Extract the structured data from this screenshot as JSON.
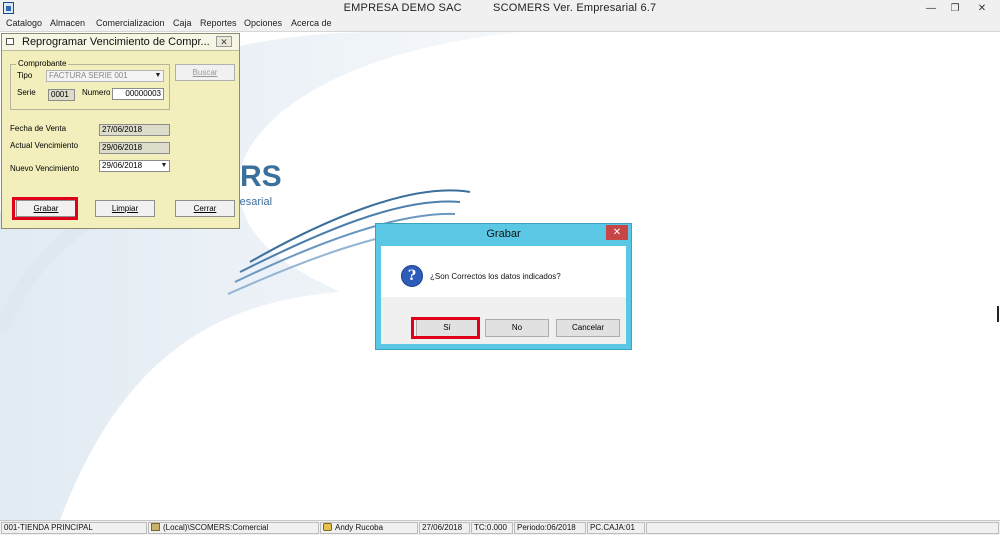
{
  "window": {
    "title_company": "EMPRESA DEMO SAC",
    "title_app": "SCOMERS Ver. Empresarial  6.7",
    "minimize": "—",
    "restore": "❐",
    "close": "✕"
  },
  "menu": [
    "Catalogo",
    "Almacen",
    "Comercializacion",
    "Caja",
    "Reportes",
    "Opciones",
    "Acerca de"
  ],
  "background": {
    "logo_text": "RS",
    "logo_sub": "resarial"
  },
  "form": {
    "title": "Reprogramar Vencimiento de Compr...",
    "close": "✕",
    "group_label": "Comprobante",
    "tipo_label": "Tipo",
    "tipo_value": "FACTURA SERIE 001",
    "buscar_button": "Buscar",
    "serie_label": "Serie",
    "serie_value": "0001",
    "numero_label": "Numero",
    "numero_value": "00000003",
    "fecha_venta_label": "Fecha de Venta",
    "fecha_venta_value": "27/06/2018",
    "actual_venc_label": "Actual Vencimiento",
    "actual_venc_value": "29/06/2018",
    "nuevo_venc_label": "Nuevo Vencimiento",
    "nuevo_venc_value": "29/06/2018",
    "grabar_button": "Grabar",
    "limpiar_button": "Limpiar",
    "cerrar_button": "Cerrar"
  },
  "dialog": {
    "title": "Grabar",
    "close": "✕",
    "icon": "question-icon",
    "message": "¿Son Correctos los datos indicados?",
    "yes": "Sí",
    "no": "No",
    "cancel": "Cancelar"
  },
  "status": {
    "tienda": "001-TIENDA PRINCIPAL",
    "db": "(Local)\\SCOMERS:Comercial",
    "user": "Andy Rucoba",
    "date": "27/06/2018",
    "tc": "TC:0.000",
    "periodo": "Periodo:06/2018",
    "caja": "PC.CAJA:01"
  },
  "colors": {
    "form_bg": "#f2efbd",
    "dialog_frame": "#5ac7e4",
    "highlight": "#e0001b",
    "swoosh": "#3b6f9c"
  }
}
